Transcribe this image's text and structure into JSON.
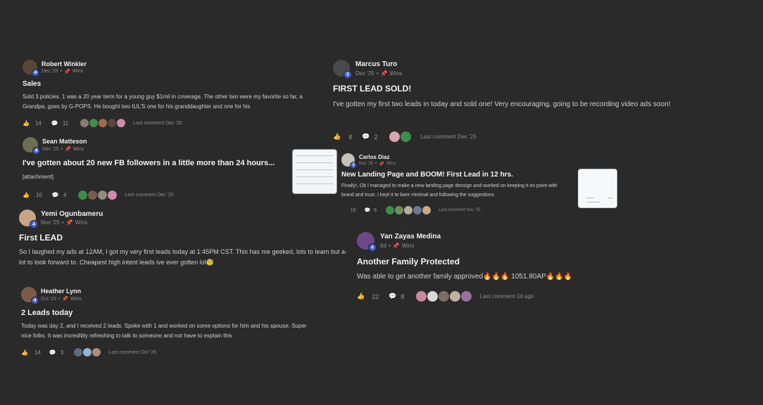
{
  "posts": [
    {
      "author": "Robert Winkler",
      "level": "4",
      "date": "Dec '25",
      "category": "Wins",
      "title": "Sales",
      "body": "Sold 3 policies. 1 was a 20 year term for a young guy $1mil in coverage. The other two were my favorite so far, a Grandpa, goes by G-POPS. He bought two IUL'S one for his granddaughter and one for his",
      "likes": "14",
      "comments": "11",
      "last_comment": "Last comment Dec '25"
    },
    {
      "author": "Sean Matteson",
      "level": "4",
      "date": "Dec '25",
      "category": "Wins",
      "title": "I've gotten about 20 new FB followers in a little more than 24 hours...",
      "body": "[attachment]",
      "likes": "10",
      "comments": "4",
      "last_comment": "Last comment Dec '25"
    },
    {
      "author": "Yemi Ogunbameru",
      "level": "4",
      "date": "Nov '25",
      "category": "Wins",
      "title": "First LEAD",
      "body": "So I laughed my ads at 12AM, I got my very first leads today at 1:45PM CST. This has me geeked, lots to learn but a-lot to look forward to. Cheapest high intent leads ive ever gotten lol🧐"
    },
    {
      "author": "Heather Lynn",
      "level": "4",
      "date": "Oct '25",
      "category": "Wins",
      "title": "2 Leads today",
      "body": "Today was day 2, and I received 2 leads. Spoke with 1 and worked on some options for him and his spouse. Super nice folks. It was incredibly refreshing to talk to someone and not have to explain this",
      "likes": "14",
      "comments": "3",
      "last_comment": "Last comment Oct '25"
    },
    {
      "author": "Marcus Turo",
      "level": "3",
      "date": "Dec '25",
      "category": "Wins",
      "title": "FIRST LEAD SOLD!",
      "body": "I've gotten my first two leads in today and sold one! Very encouraging, going to be recording video ads soon!",
      "likes": "8",
      "comments": "2",
      "last_comment": "Last comment Dec '25"
    },
    {
      "author": "Carlos Diaz",
      "level": "3",
      "date": "Nov '25",
      "category": "Wins",
      "title": "New Landing Page and BOOM! First Lead in 12 hrs.",
      "body": "Finally!, Ok I managed to make a new landing page dessign and worked on keeping it on point with brand and trust. I kept it to bare minimal and following the suggesitons",
      "likes": "15",
      "comments": "6",
      "last_comment": "Last comment Nov '25"
    },
    {
      "author": "Yan Zayas Medina",
      "level": "4",
      "date": "6d",
      "category": "Wins",
      "title": "Another Family Protected",
      "body": "Was able to get another family approved🔥🔥🔥 1051.80AP🔥🔥🔥",
      "likes": "22",
      "comments": "8",
      "last_comment": "Last comment 1d ago"
    }
  ],
  "icons": {
    "like": "thumbs-up-icon",
    "comment": "comment-bubble-icon",
    "category": "pin-icon"
  },
  "colors": {
    "background": "#2a2a2a",
    "level_badge": "#3b5bdb",
    "like_icon": "#e2b53a"
  }
}
